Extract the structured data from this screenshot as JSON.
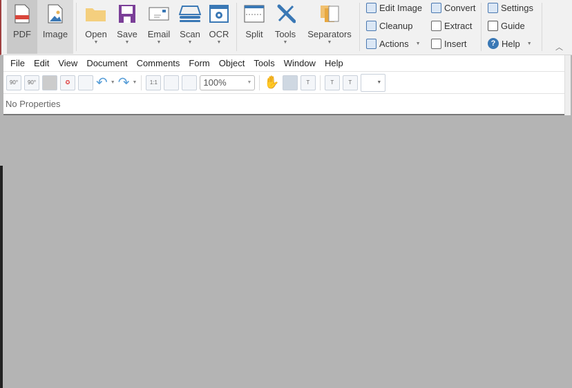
{
  "ribbon": {
    "view_buttons": [
      {
        "label": "PDF"
      },
      {
        "label": "Image"
      }
    ],
    "file_buttons": [
      {
        "label": "Open"
      },
      {
        "label": "Save"
      },
      {
        "label": "Email"
      },
      {
        "label": "Scan"
      },
      {
        "label": "OCR"
      }
    ],
    "page_buttons": [
      {
        "label": "Split"
      },
      {
        "label": "Tools"
      },
      {
        "label": "Separators"
      }
    ],
    "image_actions": [
      "Edit Image",
      "Cleanup",
      "Actions"
    ],
    "convert_actions": [
      "Convert",
      "Extract",
      "Insert"
    ],
    "help_actions": [
      "Settings",
      "Guide",
      "Help"
    ]
  },
  "menu": [
    "File",
    "Edit",
    "View",
    "Document",
    "Comments",
    "Form",
    "Object",
    "Tools",
    "Window",
    "Help"
  ],
  "toolbar": {
    "zoom_value": "100%"
  },
  "properties": {
    "text": "No Properties"
  }
}
